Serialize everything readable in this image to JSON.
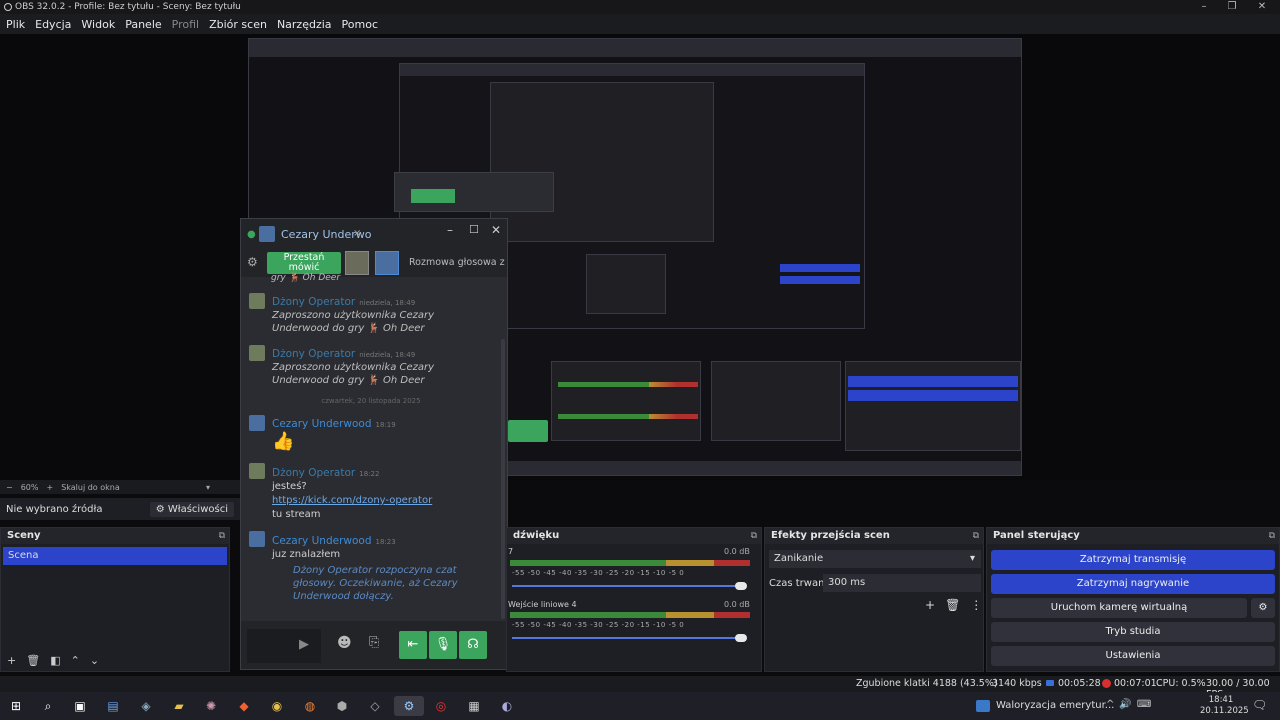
{
  "window": {
    "title": "OBS 32.0.2 - Profile: Bez tytułu - Sceny: Bez tytułu"
  },
  "menu": [
    "Plik",
    "Edycja",
    "Widok",
    "Panele",
    "Profil",
    "Zbiór scen",
    "Narzędzia",
    "Pomoc"
  ],
  "zoom": {
    "value": "60%",
    "fit_label": "Skaluj do okna"
  },
  "sources_bar": {
    "none_selected": "Nie wybrano źródła",
    "properties": "Właściwości"
  },
  "scenes": {
    "title": "Sceny",
    "items": [
      "Scena"
    ]
  },
  "audio": {
    "title": "dźwięku",
    "tracks": [
      {
        "name": "7",
        "db": "0.0 dB"
      },
      {
        "name": "Wejście liniowe 4",
        "db": "0.0 dB"
      }
    ],
    "scale": "-55 -50 -45 -40 -35 -30 -25 -20 -15 -10 -5 0"
  },
  "transitions": {
    "title": "Efekty przejścia scen",
    "selected": "Zanikanie",
    "duration_label": "Czas trwania",
    "duration_value": "300 ms"
  },
  "controls": {
    "title": "Panel sterujący",
    "stop_stream": "Zatrzymaj transmisję",
    "stop_record": "Zatrzymaj nagrywanie",
    "virtual_cam": "Uruchom kamerę wirtualną",
    "studio": "Tryb studia",
    "settings": "Ustawienia"
  },
  "chat": {
    "window_title": "Cezary Underwo",
    "stop_talking": "Przestań mówić",
    "voice_call": "Rozmowa głosowa z użytk",
    "scroll_cut": "gry 🦌 Oh Deer",
    "messages": [
      {
        "author": "Dżony Operator",
        "time": "niedziela, 18:49",
        "text": "Zaproszono użytkownika Cezary Underwood do gry 🦌 Oh Deer",
        "type": "system"
      },
      {
        "author": "Dżony Operator",
        "time": "niedziela, 18:49",
        "text": "Zaproszono użytkownika Cezary Underwood do gry 🦌 Oh Deer",
        "type": "system"
      }
    ],
    "date_divider": "czwartek, 20 listopada 2025",
    "msg3": {
      "author": "Cezary Underwood",
      "time": "18:19",
      "text": "👍"
    },
    "msg4": {
      "author": "Dżony Operator",
      "time": "18:22",
      "line1": "jesteś?",
      "link": "https://kick.com/dzony-operator",
      "line3": "tu stream"
    },
    "msg5": {
      "author": "Cezary Underwood",
      "time": "18:23",
      "line1": "juz znalazłem",
      "system": "Dżony Operator rozpoczyna czat głosowy. Oczekiwanie, aż Cezary Underwood dołączy."
    }
  },
  "status": {
    "dropped": "Zgubione klatki 4188 (43.5%)",
    "bitrate": "3140 kbps",
    "stream_time": "00:05:28",
    "rec_time": "00:07:01",
    "cpu": "CPU: 0.5%",
    "fps": "30.00 / 30.00 FPS"
  },
  "taskbar": {
    "notification": "Waloryzacja emerytur...",
    "time": "18:41",
    "date": "20.11.2025"
  },
  "colors": {
    "accent": "#2b44c9",
    "green": "#3ba55d"
  }
}
